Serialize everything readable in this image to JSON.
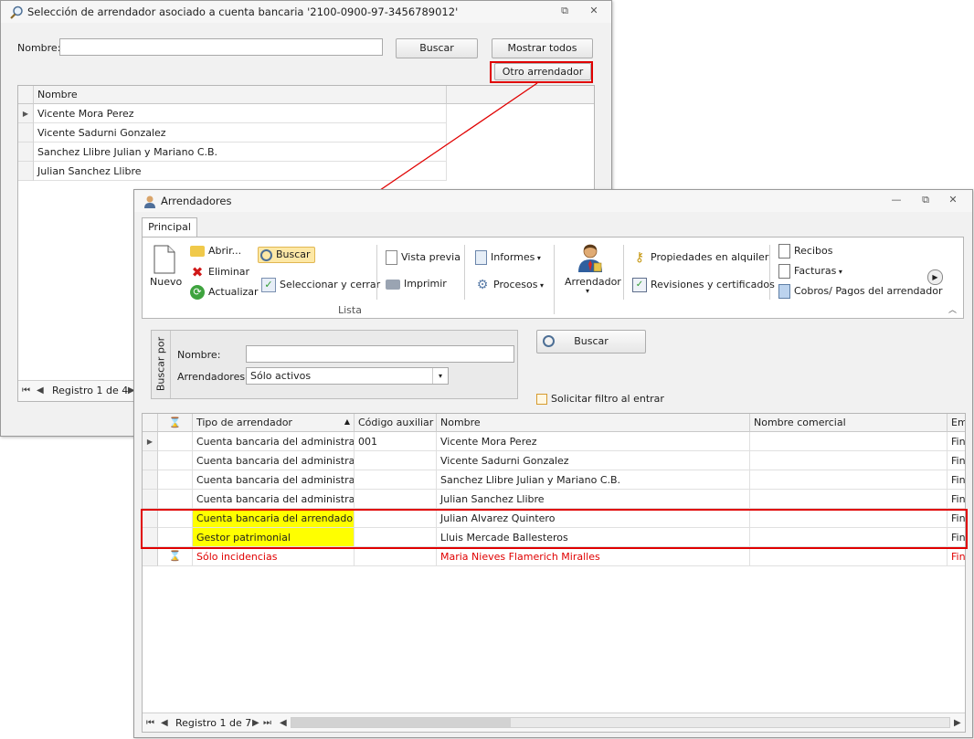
{
  "dialog1": {
    "title": "Selección de arrendador asociado a cuenta bancaria '2100-0900-97-3456789012'",
    "nombre_label": "Nombre:",
    "nombre_value": "",
    "buscar": "Buscar",
    "mostrar_todos": "Mostrar todos",
    "otro_arrendador": "Otro arrendador",
    "column": "Nombre",
    "rows": [
      "Vicente Mora Perez",
      "Vicente Sadurni Gonzalez",
      "Sanchez Llibre Julian y Mariano C.B.",
      "Julian Sanchez Llibre"
    ],
    "status": "Registro 1 de 4"
  },
  "dialog2": {
    "title": "Arrendadores",
    "tab": "Principal",
    "ribbon": {
      "nuevo": "Nuevo",
      "abrir": "Abrir...",
      "eliminar": "Eliminar",
      "actualizar": "Actualizar",
      "buscar": "Buscar",
      "seleccionar_cerrar": "Seleccionar y cerrar",
      "vista_previa": "Vista previa",
      "imprimir": "Imprimir",
      "informes": "Informes",
      "procesos": "Procesos",
      "arrendador": "Arrendador",
      "propiedades": "Propiedades en alquiler",
      "revisiones": "Revisiones y certificados",
      "recibos": "Recibos",
      "facturas": "Facturas",
      "cobros": "Cobros/ Pagos del arrendador",
      "group_label": "Lista"
    },
    "search": {
      "side_label": "Buscar por",
      "nombre_label": "Nombre:",
      "nombre_value": "",
      "arrendadores_label": "Arrendadores:",
      "arrendadores_value": "Sólo activos",
      "buscar": "Buscar",
      "solicitar": "Solicitar filtro al entrar"
    },
    "columns": [
      "Tipo de arrendador",
      "Código auxiliar",
      "Nombre",
      "Nombre comercial",
      "Emp"
    ],
    "rows": [
      {
        "tipo": "Cuenta bancaria del administrador",
        "codigo": "001",
        "nombre": "Vicente Mora Perez",
        "comercial": "",
        "emp": "Fin"
      },
      {
        "tipo": "Cuenta bancaria del administrador",
        "codigo": "",
        "nombre": "Vicente Sadurni Gonzalez",
        "comercial": "",
        "emp": "Fin"
      },
      {
        "tipo": "Cuenta bancaria del administrador",
        "codigo": "",
        "nombre": "Sanchez Llibre Julian y Mariano C.B.",
        "comercial": "",
        "emp": "Fin"
      },
      {
        "tipo": "Cuenta bancaria del administrador",
        "codigo": "",
        "nombre": "Julian Sanchez Llibre",
        "comercial": "",
        "emp": "Fin"
      },
      {
        "tipo": "Cuenta bancaria del arrendador",
        "codigo": "",
        "nombre": "Julian Alvarez Quintero",
        "comercial": "",
        "emp": "Fin"
      },
      {
        "tipo": "Gestor patrimonial",
        "codigo": "",
        "nombre": "Lluis Mercade Ballesteros",
        "comercial": "",
        "emp": "Fin"
      },
      {
        "tipo": "Sólo incidencias",
        "codigo": "",
        "nombre": "Maria Nieves Flamerich Miralles",
        "comercial": "",
        "emp": "Fin"
      }
    ],
    "status": "Registro 1 de 7"
  },
  "colors": {
    "highlight": "#ffff00",
    "annotation_red": "#e00000",
    "incidencia_red": "#e00000"
  }
}
